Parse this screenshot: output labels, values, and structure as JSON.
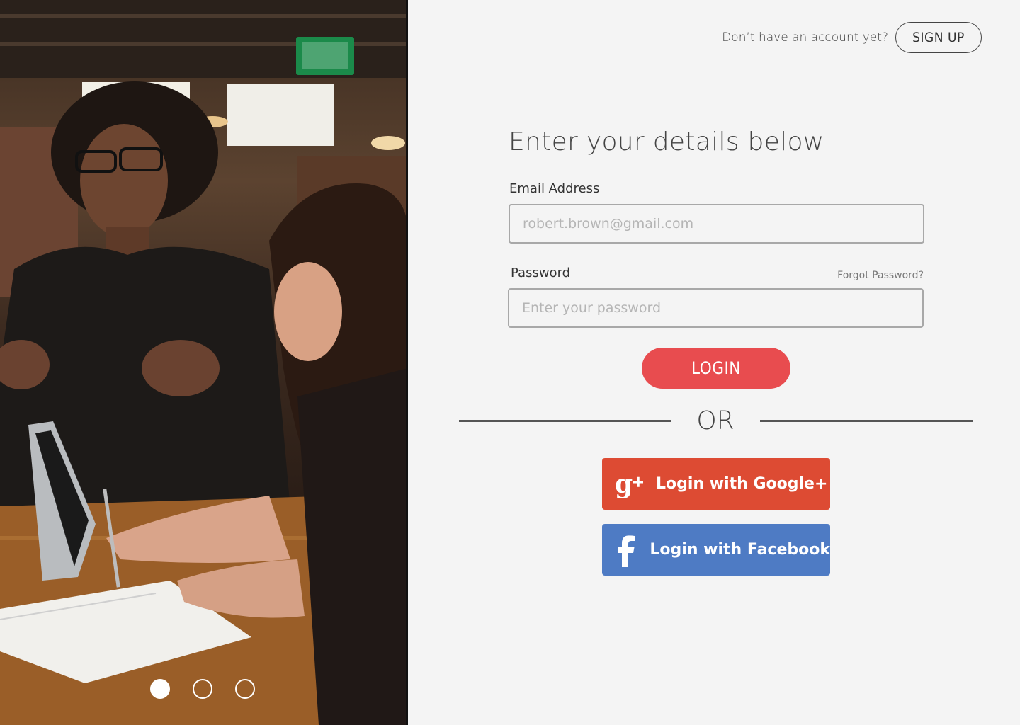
{
  "carousel": {
    "slides": 3,
    "active_index": 0
  },
  "signup": {
    "prompt": "Don’t have an account yet?",
    "button_label": "SIGN UP"
  },
  "form": {
    "title": "Enter your details below",
    "email_label": "Email Address",
    "email_placeholder": "robert.brown@gmail.com",
    "password_label": "Password",
    "forgot_label": "Forgot Password?",
    "password_placeholder": "Enter your password",
    "login_label": "LOGIN",
    "or_label": "OR"
  },
  "social": {
    "google_label": "Login with Google+",
    "facebook_label": "Login with Facebook",
    "google_icon": "google-plus-icon",
    "facebook_icon": "facebook-icon"
  },
  "colors": {
    "login": "#e84c4f",
    "google": "#dd4b33",
    "facebook": "#4e7bc4",
    "background": "#f4f4f4"
  }
}
